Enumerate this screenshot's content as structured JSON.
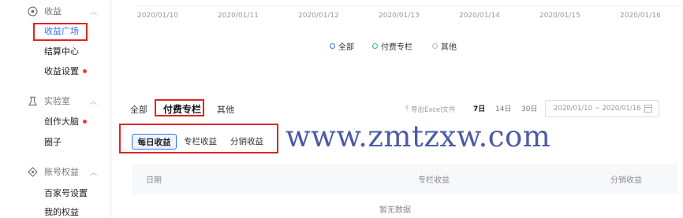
{
  "sidebar": {
    "groups": [
      {
        "title": "收益",
        "icon": "coin-icon",
        "items": [
          {
            "label": "收益广场",
            "active": true,
            "dot": false
          },
          {
            "label": "结算中心",
            "active": false,
            "dot": false
          },
          {
            "label": "收益设置",
            "active": false,
            "dot": true
          }
        ]
      },
      {
        "title": "实验室",
        "icon": "flask-icon",
        "items": [
          {
            "label": "创作大脑",
            "active": false,
            "dot": true
          },
          {
            "label": "圈子",
            "active": false,
            "dot": false
          }
        ]
      },
      {
        "title": "账号权益",
        "icon": "badge-icon",
        "items": [
          {
            "label": "百家号设置",
            "active": false,
            "dot": false
          },
          {
            "label": "我的权益",
            "active": false,
            "dot": false
          }
        ]
      }
    ]
  },
  "chart": {
    "x_labels": [
      "2020/01/10",
      "2020/01/11",
      "2020/01/12",
      "2020/01/13",
      "2020/01/14",
      "2020/01/15",
      "2020/01/16"
    ],
    "legend": [
      "全部",
      "付费专栏",
      "其他"
    ],
    "legend_colors": [
      "#3a6ff7",
      "#2bb5a0",
      "#b9b9b9"
    ]
  },
  "tabs": [
    "全部",
    "付费专栏",
    "其他"
  ],
  "toolbar": {
    "export_label": "导出Excel文件",
    "periods": [
      "7日",
      "14日",
      "30日"
    ],
    "date_range": "2020/01/10  ~  2020/01/16"
  },
  "subtabs": [
    "每日收益",
    "专栏收益",
    "分销收益"
  ],
  "table": {
    "columns": [
      "日期",
      "专栏收益",
      "分销收益"
    ],
    "empty_text": "暂无数据"
  },
  "watermark": "www.zmtzxw.com",
  "colors": {
    "accent": "#3a6ff7",
    "highlight_box": "#e02424",
    "dot": "#ee3b3b"
  }
}
